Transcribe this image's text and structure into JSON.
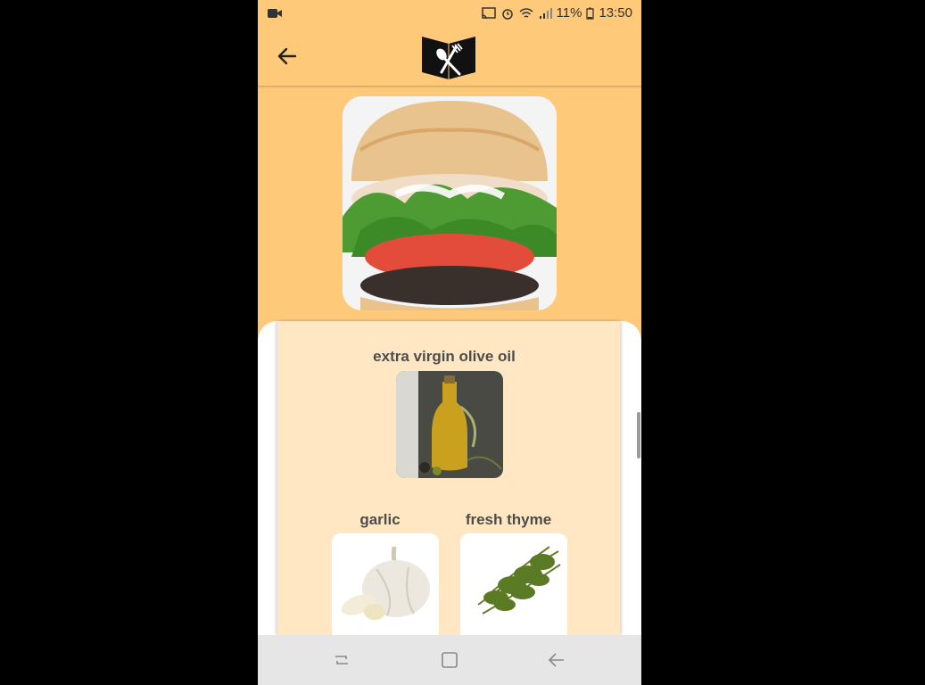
{
  "status_bar": {
    "battery": "11%",
    "time": "13:50"
  },
  "app_bar": {
    "back_icon": "arrow-left-icon",
    "logo_icon": "cookbook-logo-icon"
  },
  "recipe": {
    "hero_image": "portobello-burger-photo"
  },
  "ingredients": [
    {
      "name": "extra virgin olive oil",
      "image": "olive-oil-bottle-photo"
    },
    {
      "name": "garlic",
      "image": "garlic-bulb-photo"
    },
    {
      "name": "fresh thyme",
      "image": "thyme-sprigs-photo"
    }
  ],
  "nav_bar": {
    "recents_icon": "recents-icon",
    "home_icon": "home-icon",
    "back_icon": "back-icon"
  },
  "colors": {
    "accent": "#ffc97a",
    "card": "#ffe7c3",
    "nav": "#e6e6e6"
  }
}
